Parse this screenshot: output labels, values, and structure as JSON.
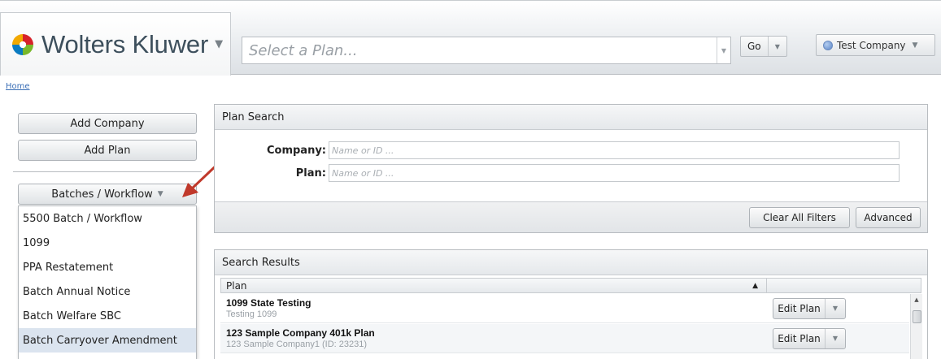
{
  "header": {
    "brand": "Wolters Kluwer",
    "plan_select_placeholder": "Select a Plan...",
    "go_label": "Go",
    "company_label": "Test Company"
  },
  "breadcrumb": {
    "home": "Home"
  },
  "sidebar": {
    "add_company": "Add Company",
    "add_plan": "Add Plan",
    "batches_label": "Batches / Workflow",
    "menu_items": [
      "5500 Batch / Workflow",
      "1099",
      "PPA Restatement",
      "Batch Annual Notice",
      "Batch Welfare SBC",
      "Batch Carryover Amendment"
    ],
    "selected_item": "Batch Carryover Amendment"
  },
  "plan_search": {
    "title": "Plan Search",
    "company_label": "Company:",
    "company_placeholder": "Name or ID ...",
    "plan_label": "Plan:",
    "plan_placeholder": "Name or ID ...",
    "clear_filters": "Clear All Filters",
    "advanced": "Advanced"
  },
  "results": {
    "title": "Search Results",
    "column_plan": "Plan",
    "rows": [
      {
        "title": "1099 State Testing",
        "subtitle": "Testing 1099",
        "action": "Edit Plan"
      },
      {
        "title": "123 Sample Company 401k Plan",
        "subtitle": "123 Sample Company1 (ID: 23231)",
        "action": "Edit Plan"
      }
    ]
  },
  "colors": {
    "link": "#3b6fb6",
    "annotation_arrow": "#c0392b",
    "selected_row": "#dbe4ef"
  }
}
